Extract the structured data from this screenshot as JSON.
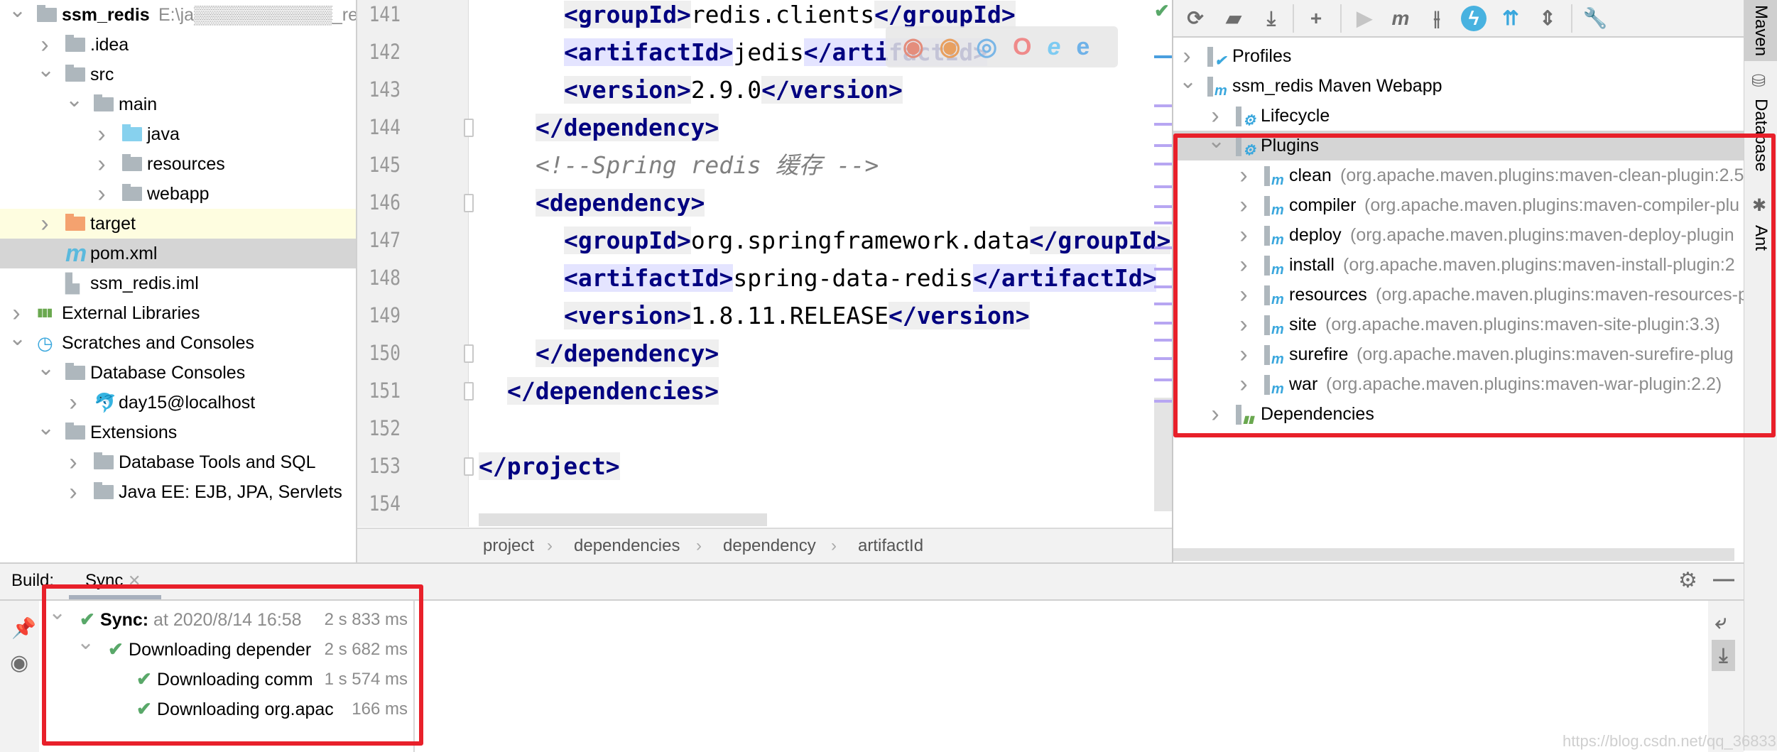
{
  "project_tree": [
    {
      "level": 0,
      "chev": "down",
      "icon": "module-folder",
      "label": "ssm_redis",
      "sub": "E:\\ja▒▒▒▒▒▒▒▒▒▒▒_redis",
      "bold": true
    },
    {
      "level": 1,
      "chev": "right",
      "icon": "folder",
      "label": ".idea"
    },
    {
      "level": 1,
      "chev": "down",
      "icon": "folder",
      "label": "src"
    },
    {
      "level": 2,
      "chev": "down",
      "icon": "folder",
      "label": "main"
    },
    {
      "level": 3,
      "chev": "right",
      "icon": "source-folder",
      "label": "java"
    },
    {
      "level": 3,
      "chev": "right",
      "icon": "resources-folder",
      "label": "resources"
    },
    {
      "level": 3,
      "chev": "right",
      "icon": "web-folder",
      "label": "webapp"
    },
    {
      "level": 1,
      "chev": "right",
      "icon": "excluded-folder",
      "label": "target",
      "state": "highlighted"
    },
    {
      "level": 1,
      "chev": "",
      "icon": "maven-file",
      "label": "pom.xml",
      "state": "selected"
    },
    {
      "level": 1,
      "chev": "",
      "icon": "iml-file",
      "label": "ssm_redis.iml"
    },
    {
      "level": 0,
      "chev": "right",
      "icon": "libraries",
      "label": "External Libraries"
    },
    {
      "level": 0,
      "chev": "down",
      "icon": "scratches",
      "label": "Scratches and Consoles"
    },
    {
      "level": 1,
      "chev": "down",
      "icon": "folder",
      "label": "Database Consoles"
    },
    {
      "level": 2,
      "chev": "right",
      "icon": "mysql",
      "label": "day15@localhost"
    },
    {
      "level": 1,
      "chev": "down",
      "icon": "folder",
      "label": "Extensions"
    },
    {
      "level": 2,
      "chev": "right",
      "icon": "folder",
      "label": "Database Tools and SQL"
    },
    {
      "level": 2,
      "chev": "right",
      "icon": "folder",
      "label": "Java EE: EJB, JPA, Servlets"
    }
  ],
  "editor": {
    "lines": [
      {
        "n": "141",
        "indent": 3,
        "tokens": [
          [
            "tag",
            "<groupId>"
          ],
          [
            "text",
            "redis.clients"
          ],
          [
            "tag",
            "</groupId>"
          ]
        ]
      },
      {
        "n": "142",
        "indent": 3,
        "tokens": [
          [
            "art",
            "<artifactId>"
          ],
          [
            "text",
            "jedis"
          ],
          [
            "art",
            "</artifactId>"
          ]
        ]
      },
      {
        "n": "143",
        "indent": 3,
        "tokens": [
          [
            "tag",
            "<version>"
          ],
          [
            "text",
            "2.9.0"
          ],
          [
            "tag",
            "</version>"
          ]
        ]
      },
      {
        "n": "144",
        "indent": 2,
        "fold": true,
        "tokens": [
          [
            "tag",
            "</dependency>"
          ]
        ]
      },
      {
        "n": "145",
        "indent": 2,
        "tokens": [
          [
            "comment",
            "<!--Spring redis 缓存 -->"
          ]
        ]
      },
      {
        "n": "146",
        "indent": 2,
        "fold": true,
        "tokens": [
          [
            "tag",
            "<dependency>"
          ]
        ]
      },
      {
        "n": "147",
        "indent": 3,
        "tokens": [
          [
            "tag",
            "<groupId>"
          ],
          [
            "text",
            "org.springframework.data"
          ],
          [
            "tag",
            "</groupId>"
          ]
        ]
      },
      {
        "n": "148",
        "indent": 3,
        "tokens": [
          [
            "art",
            "<artifactId>"
          ],
          [
            "text",
            "spring-data-redis"
          ],
          [
            "art",
            "</artifactId>"
          ]
        ]
      },
      {
        "n": "149",
        "indent": 3,
        "tokens": [
          [
            "tag",
            "<version>"
          ],
          [
            "text",
            "1.8.11.RELEASE"
          ],
          [
            "tag",
            "</version>"
          ]
        ]
      },
      {
        "n": "150",
        "indent": 2,
        "fold": true,
        "tokens": [
          [
            "tag",
            "</dependency>"
          ]
        ]
      },
      {
        "n": "151",
        "indent": 1,
        "fold": true,
        "tokens": [
          [
            "tag",
            "</dependencies>"
          ]
        ]
      },
      {
        "n": "152",
        "indent": 0,
        "tokens": []
      },
      {
        "n": "153",
        "indent": 0,
        "fold": true,
        "tokens": [
          [
            "tag",
            "</project>"
          ]
        ]
      },
      {
        "n": "154",
        "indent": 0,
        "tokens": []
      }
    ],
    "breadcrumb": [
      "project",
      "dependencies",
      "dependency",
      "artifactId"
    ],
    "browser_icons": [
      "chrome",
      "firefox",
      "safari",
      "opera",
      "ie",
      "edge"
    ]
  },
  "maven": {
    "toolbar": [
      "reload",
      "generate-sources",
      "download",
      "add",
      "run",
      "execute-goal",
      "toggle-offline",
      "skip-tests",
      "show-dependencies",
      "collapse-all",
      "settings"
    ],
    "tree": [
      {
        "level": 0,
        "chev": "right",
        "icon": "profiles",
        "label": "Profiles"
      },
      {
        "level": 0,
        "chev": "down",
        "icon": "maven-project",
        "label": "ssm_redis Maven Webapp"
      },
      {
        "level": 1,
        "chev": "right",
        "icon": "lifecycle",
        "label": "Lifecycle"
      },
      {
        "level": 1,
        "chev": "down",
        "icon": "plugins",
        "label": "Plugins",
        "state": "selected"
      },
      {
        "level": 2,
        "chev": "right",
        "icon": "plugin",
        "label": "clean",
        "sub": "(org.apache.maven.plugins:maven-clean-plugin:2.5"
      },
      {
        "level": 2,
        "chev": "right",
        "icon": "plugin",
        "label": "compiler",
        "sub": "(org.apache.maven.plugins:maven-compiler-plu"
      },
      {
        "level": 2,
        "chev": "right",
        "icon": "plugin",
        "label": "deploy",
        "sub": "(org.apache.maven.plugins:maven-deploy-plugin"
      },
      {
        "level": 2,
        "chev": "right",
        "icon": "plugin",
        "label": "install",
        "sub": "(org.apache.maven.plugins:maven-install-plugin:2"
      },
      {
        "level": 2,
        "chev": "right",
        "icon": "plugin",
        "label": "resources",
        "sub": "(org.apache.maven.plugins:maven-resources-p"
      },
      {
        "level": 2,
        "chev": "right",
        "icon": "plugin",
        "label": "site",
        "sub": "(org.apache.maven.plugins:maven-site-plugin:3.3)"
      },
      {
        "level": 2,
        "chev": "right",
        "icon": "plugin",
        "label": "surefire",
        "sub": "(org.apache.maven.plugins:maven-surefire-plug"
      },
      {
        "level": 2,
        "chev": "right",
        "icon": "plugin",
        "label": "war",
        "sub": "(org.apache.maven.plugins:maven-war-plugin:2.2)"
      },
      {
        "level": 1,
        "chev": "right",
        "icon": "dependencies",
        "label": "Dependencies"
      }
    ]
  },
  "right_stripe": {
    "maven": "Maven",
    "database": "Database",
    "ant": "Ant"
  },
  "build": {
    "label": "Build:",
    "tab": "Sync",
    "rows": [
      {
        "level": 0,
        "chev": "down",
        "bold": "Sync:",
        "label": " at 2020/8/14 16:58",
        "label_color": "#8c8c8c",
        "time": "2 s 833 ms"
      },
      {
        "level": 1,
        "chev": "down",
        "label": "Downloading depender",
        "time": "2 s 682 ms"
      },
      {
        "level": 2,
        "label": "Downloading comm",
        "time": "1 s 574 ms"
      },
      {
        "level": 2,
        "label": "Downloading org.apach",
        "time": "166 ms"
      }
    ]
  },
  "watermark": "https://blog.csdn.net/qq_36833593",
  "colors": {
    "annotation": "#e8202a",
    "success": "#59a869",
    "tag": "#000080",
    "selection": "#d5d5d5"
  }
}
